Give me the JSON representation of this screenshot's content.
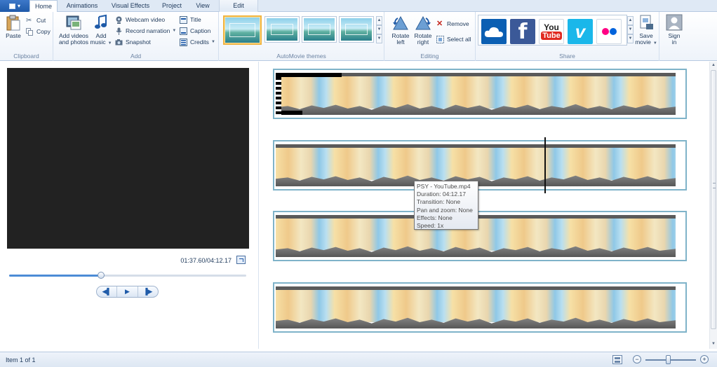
{
  "tabs": [
    {
      "label": "Home",
      "active": true
    },
    {
      "label": "Animations"
    },
    {
      "label": "Visual Effects"
    },
    {
      "label": "Project"
    },
    {
      "label": "View"
    },
    {
      "label": "Edit",
      "contextual": true
    }
  ],
  "ribbon": {
    "clipboard": {
      "label": "Clipboard",
      "paste": "Paste",
      "cut": "Cut",
      "copy": "Copy"
    },
    "add": {
      "label": "Add",
      "add_videos_line1": "Add videos",
      "add_videos_line2": "and photos",
      "add_music_line1": "Add",
      "add_music_line2": "music",
      "webcam": "Webcam video",
      "narration": "Record narration",
      "snapshot": "Snapshot",
      "title": "Title",
      "caption": "Caption",
      "credits": "Credits"
    },
    "themes": {
      "label": "AutoMovie themes",
      "selected_index": 0,
      "count": 4
    },
    "editing": {
      "label": "Editing",
      "rotate_left_line1": "Rotate",
      "rotate_left_line2": "left",
      "rotate_right_line1": "Rotate",
      "rotate_right_line2": "right",
      "remove": "Remove",
      "select_all": "Select all"
    },
    "share": {
      "label": "Share",
      "services": [
        "onedrive-icon",
        "facebook-icon",
        "youtube-icon",
        "vimeo-icon",
        "flickr-icon"
      ],
      "youtube_text_1": "You",
      "youtube_text_2": "Tube",
      "facebook_text": "f",
      "vimeo_text": "v",
      "save_movie_line1": "Save",
      "save_movie_line2": "movie",
      "sign_in_line1": "Sign",
      "sign_in_line2": "in"
    }
  },
  "preview": {
    "timecode": "01:37.60/04:12.17",
    "progress": 0.387
  },
  "tooltip": {
    "lines": [
      "PSY - YouTube.mp4",
      "Duration: 04:12.17",
      "Transition: None",
      "Pan and zoom: None",
      "Effects: None",
      "Speed: 1x"
    ]
  },
  "status": {
    "text": "Item 1 of 1",
    "zoom_level": 0.45
  },
  "colors": {
    "accent": "#1e5aa8",
    "onedrive": "#0b5fb3",
    "facebook": "#3b5998",
    "youtube_red": "#e02a20",
    "vimeo": "#1ab7ea",
    "track_border": "#7fb3c9",
    "theme_selected": "#f0b441"
  }
}
